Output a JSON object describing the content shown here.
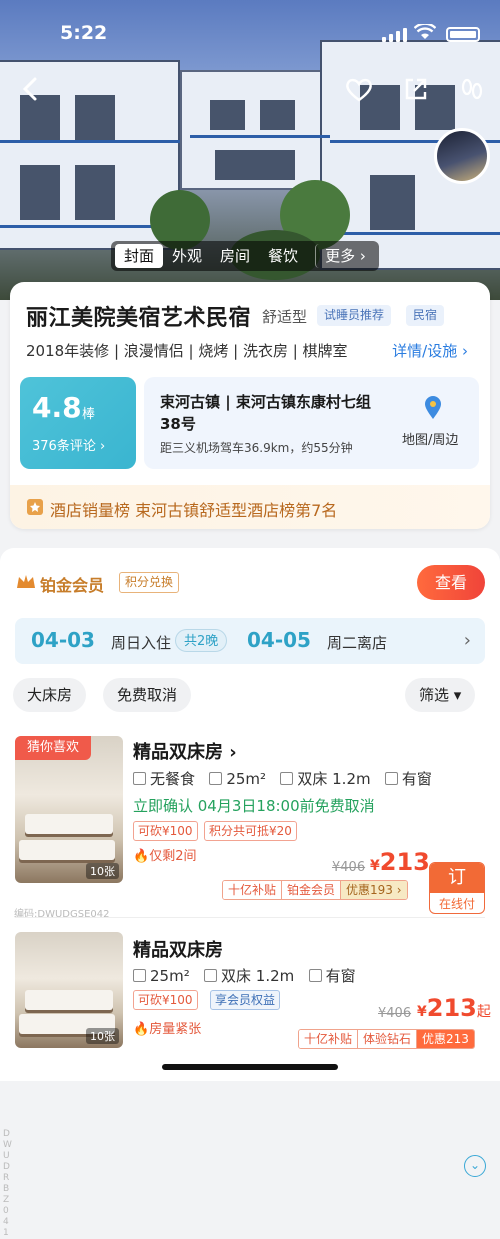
{
  "status": {
    "time": "5:22"
  },
  "hero": {
    "tabs": [
      "封面",
      "外观",
      "房间",
      "餐饮"
    ],
    "more_label": "更多",
    "icons": [
      "back-icon",
      "favorite-heart-icon",
      "share-icon",
      "footprint-icon"
    ]
  },
  "hotel": {
    "name": "丽江美院美宿艺术民宿",
    "type": "舒适型",
    "tags": [
      "试睡员推荐",
      "民宿"
    ],
    "features": "2018年装修 | 浪漫情侣 | 烧烤 | 洗衣房 | 棋牌室",
    "detail_link": "详情/设施 ›",
    "score": "4.8",
    "score_unit": "棒",
    "reviews": "376条评论 ›",
    "address": "束河古镇 | 束河古镇东康村七组38号",
    "distance": "距三义机场驾车36.9km，约55分钟",
    "map_label": "地图/周边",
    "rank_text": "酒店销量榜 束河古镇舒适型酒店榜第7名"
  },
  "membership": {
    "title": "铂金会员",
    "badge": "积分兑换",
    "view_button": "查看"
  },
  "dates": {
    "checkin": "04-03",
    "checkin_label": "周日入住",
    "nights": "共2晚",
    "checkout": "04-05",
    "checkout_label": "周二离店"
  },
  "filters": {
    "chips": [
      "大床房",
      "免费取消"
    ],
    "sort": "筛选 ▾"
  },
  "rooms": [
    {
      "badge": "猜你喜欢",
      "name": "精品双床房 ›",
      "info": [
        "无餐食",
        "25m²",
        "双床 1.2m",
        "有窗"
      ],
      "confirm": "立即确认  04月3日18:00前免费取消",
      "tags": [
        "可砍¥100",
        "积分共可抵¥20"
      ],
      "hot": "仅剩2间",
      "old_price": "¥406",
      "price": "213",
      "book_top": "订",
      "book_bottom": "在线付",
      "promos": [
        "十亿补贴",
        "铂金会员",
        "优惠193 ›"
      ],
      "photo_count": "10张",
      "code": "编码:DWUDGSE042"
    },
    {
      "name": "精品双床房",
      "info": [
        "25m²",
        "双床 1.2m",
        "有窗"
      ],
      "tags": [
        "可砍¥100",
        "享会员权益"
      ],
      "hot": "房量紧张",
      "old_price": "¥406",
      "price": "213",
      "price_suffix": "起",
      "promos": [
        "十亿补贴",
        "体验钻石",
        "优惠213"
      ],
      "photo_count": "10张",
      "vcode": "DWUDRBZ041"
    }
  ],
  "colors": {
    "accent_orange": "#f04a2e",
    "accent_teal": "#2ea2c6",
    "member_gold": "#c77d2a"
  }
}
